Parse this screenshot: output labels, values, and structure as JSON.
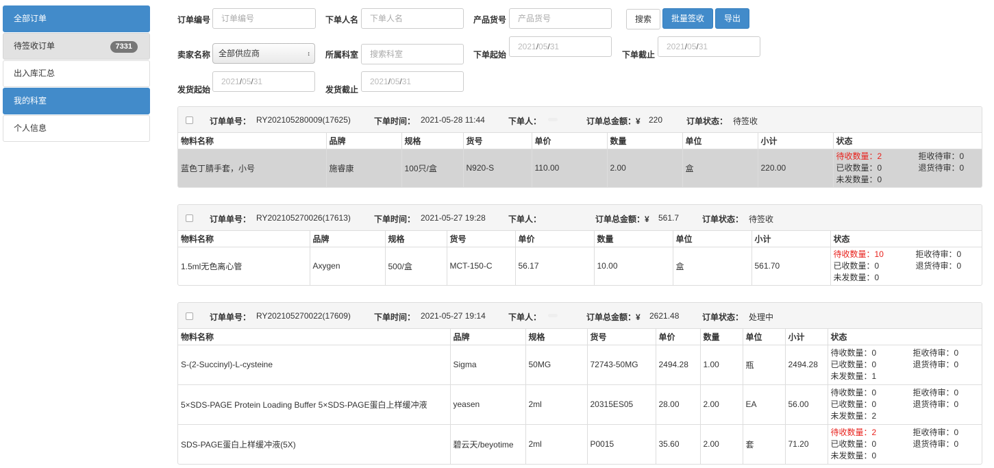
{
  "sidebar": {
    "items": [
      {
        "label": "全部订单"
      },
      {
        "label": "待签收订单",
        "badge": "7331"
      },
      {
        "label": "出入库汇总"
      },
      {
        "label": "我的科室"
      },
      {
        "label": "个人信息"
      }
    ]
  },
  "filters": {
    "order_no": {
      "label": "订单编号",
      "placeholder": "订单编号"
    },
    "orderer": {
      "label": "下单人名",
      "placeholder": "下单人名"
    },
    "product_no": {
      "label": "产品货号",
      "placeholder": "产品货号"
    },
    "seller": {
      "label": "卖家名称",
      "value": "全部供应商"
    },
    "dept": {
      "label": "所属科室",
      "placeholder": "搜索科室"
    },
    "order_start": {
      "label": "下单起始",
      "date": [
        "2021",
        "05",
        "31"
      ]
    },
    "order_end": {
      "label": "下单截止",
      "date": [
        "2021",
        "05",
        "31"
      ]
    },
    "ship_start": {
      "label": "发货起始",
      "date": [
        "2021",
        "05",
        "31"
      ]
    },
    "ship_end": {
      "label": "发货截止",
      "date": [
        "2021",
        "05",
        "31"
      ]
    },
    "search_label": "搜索",
    "batch_sign_label": "批量签收",
    "export_label": "导出"
  },
  "order_labels": {
    "order_no": "订单单号：",
    "order_time": "下单时间：",
    "orderer": "下单人：",
    "total": "订单总金额：¥",
    "status": "订单状态："
  },
  "columns": [
    "物料名称",
    "品牌",
    "规格",
    "货号",
    "单价",
    "数量",
    "单位",
    "小计",
    "状态"
  ],
  "status_labels": {
    "pending": "待收数量：",
    "received": "已收数量：",
    "unshipped": "未发数量：",
    "reject": "拒收待审：",
    "return": "退货待审："
  },
  "orders": [
    {
      "no": "RY202105280009(17625)",
      "time": "2021-05-28 11:44",
      "orderer": "",
      "total": "220",
      "status": "待签收",
      "items": [
        {
          "name": "蓝色丁腈手套，小号",
          "brand": "施睿康",
          "spec": "100只/盒",
          "code": "N920-S",
          "price": "110.00",
          "qty": "2.00",
          "unit": "盒",
          "subtotal": "220.00",
          "pending": "2",
          "received": "0",
          "unshipped": "0",
          "reject": "0",
          "return": "0"
        }
      ]
    },
    {
      "no": "RY202105270026(17613)",
      "time": "2021-05-27 19:28",
      "orderer": "",
      "total": "561.7",
      "status": "待签收",
      "items": [
        {
          "name": "1.5ml无色离心管",
          "brand": "Axygen",
          "spec": "500/盒",
          "code": "MCT-150-C",
          "price": "56.17",
          "qty": "10.00",
          "unit": "盒",
          "subtotal": "561.70",
          "pending": "10",
          "received": "0",
          "unshipped": "0",
          "reject": "0",
          "return": "0"
        }
      ]
    },
    {
      "no": "RY202105270022(17609)",
      "time": "2021-05-27 19:14",
      "orderer": "",
      "total": "2621.48",
      "status": "处理中",
      "items": [
        {
          "name": "S-(2-Succinyl)-L-cysteine",
          "brand": "Sigma",
          "spec": "50MG",
          "code": "72743-50MG",
          "price": "2494.28",
          "qty": "1.00",
          "unit": "瓶",
          "subtotal": "2494.28",
          "pending": "0",
          "received": "0",
          "unshipped": "1",
          "reject": "0",
          "return": "0"
        },
        {
          "name": "5×SDS-PAGE Protein Loading Buffer 5×SDS-PAGE蛋白上样缓冲液",
          "brand": "yeasen",
          "spec": "2ml",
          "code": "20315ES05",
          "price": "28.00",
          "qty": "2.00",
          "unit": "EA",
          "subtotal": "56.00",
          "pending": "0",
          "received": "0",
          "unshipped": "2",
          "reject": "0",
          "return": "0"
        },
        {
          "name": "SDS-PAGE蛋白上样缓冲液(5X)",
          "brand": "碧云天/beyotime",
          "spec": "2ml",
          "code": "P0015",
          "price": "35.60",
          "qty": "2.00",
          "unit": "套",
          "subtotal": "71.20",
          "pending": "2",
          "received": "0",
          "unshipped": "0",
          "reject": "0",
          "return": "0"
        }
      ]
    }
  ],
  "colors": {
    "primary": "#428bca",
    "alert": "#e8211c",
    "row_highlight": "#d4d4d4",
    "badge": "#777777"
  }
}
